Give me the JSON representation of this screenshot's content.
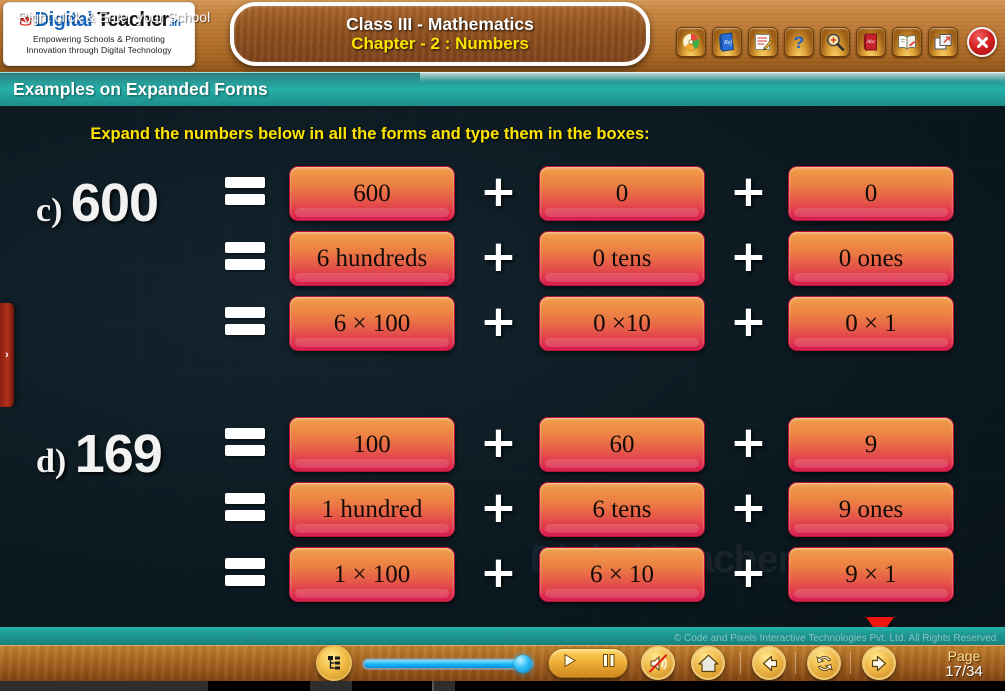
{
  "logo": {
    "brand_digital": "Digital",
    "brand_teacher": " Teacher",
    "brand_tld": ".in",
    "tagline_line1": "Empowering Schools & Promoting",
    "tagline_line2": "Innovation through Digital Technology"
  },
  "header": {
    "class_line": "Class III - Mathematics",
    "chapter_line": "Chapter - 2 : Numbers",
    "section_title": "Examples on Expanded Forms"
  },
  "toolbar": {
    "items": [
      {
        "name": "color-palette-icon",
        "label": "Colors"
      },
      {
        "name": "reference-book-icon",
        "label": "Reference"
      },
      {
        "name": "notepad-pencil-icon",
        "label": "Notes"
      },
      {
        "name": "help-question-icon",
        "label": "Help"
      },
      {
        "name": "magnifier-zoom-icon",
        "label": "Zoom"
      },
      {
        "name": "abc-dictionary-icon",
        "label": "Dictionary"
      },
      {
        "name": "open-book-icon",
        "label": "Book"
      },
      {
        "name": "restore-window-icon",
        "label": "Restore"
      }
    ],
    "close_label": "✕"
  },
  "instruction": "Expand the numbers below in all the forms and type them in the boxes:",
  "side_tab": {
    "label": "›"
  },
  "watermark": {
    "part1": "Digital",
    "part2": " Teacher"
  },
  "problems": [
    {
      "id": "c",
      "label_prefix": "c)",
      "number": "600",
      "rows": [
        {
          "equals": "=",
          "box1": "600",
          "plus1": "+",
          "box2": "0",
          "plus2": "+",
          "box3": "0"
        },
        {
          "equals": "=",
          "box1": "6 hundreds",
          "plus1": "+",
          "box2": "0 tens",
          "plus2": "+",
          "box3": "0 ones"
        },
        {
          "equals": "=",
          "box1": "6 × 100",
          "plus1": "+",
          "box2": "0 ×10",
          "plus2": "+",
          "box3": "0 × 1"
        }
      ]
    },
    {
      "id": "d",
      "label_prefix": "d)",
      "number": "169",
      "rows": [
        {
          "equals": "=",
          "box1": "100",
          "plus1": "+",
          "box2": "60",
          "plus2": "+",
          "box3": "9"
        },
        {
          "equals": "=",
          "box1": "1 hundred",
          "plus1": "+",
          "box2": "6 tens",
          "plus2": "+",
          "box3": "9 ones"
        },
        {
          "equals": "=",
          "box1": "1 × 100",
          "plus1": "+",
          "box2": "6 × 10",
          "plus2": "+",
          "box3": "9 × 1"
        }
      ]
    }
  ],
  "copyright": "© Code and Pixels Interactive Technologies  Pvt. Ltd. All Rights Reserved.",
  "footer": {
    "school_prompt": "Right click & Enter your School",
    "list_icon": "content-list-icon",
    "play_icon": "play-icon",
    "pause_icon": "pause-icon",
    "mute_icon": "speaker-mute-icon",
    "home_icon": "home-icon",
    "back_icon": "arrow-left-icon",
    "refresh_icon": "refresh-icon",
    "forward_icon": "arrow-right-icon",
    "page_label": "Page",
    "page_value": "17/34",
    "progress_percent": 93
  },
  "colors": {
    "accent_yellow": "#ffe400",
    "teal_header": "#24b0a8",
    "box_orange": "#f0a24e",
    "box_crimson": "#d6184b",
    "wood_brown": "#ac6a23",
    "stage_dark": "#0d1a22",
    "pointer_red": "#f1150e"
  }
}
